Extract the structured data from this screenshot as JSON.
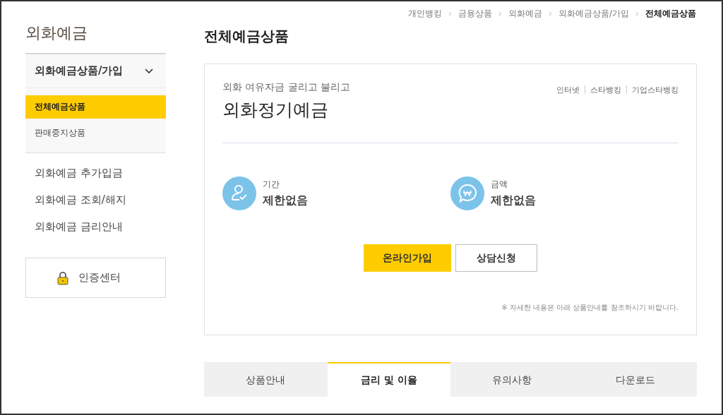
{
  "breadcrumb": [
    {
      "label": "개인뱅킹",
      "current": false
    },
    {
      "label": "금융상품",
      "current": false
    },
    {
      "label": "외화예금",
      "current": false
    },
    {
      "label": "외화예금상품/가입",
      "current": false
    },
    {
      "label": "전체예금상품",
      "current": true
    }
  ],
  "sidebar": {
    "title": "외화예금",
    "group": {
      "label": "외화예금상품/가입",
      "expanded": true,
      "children": [
        {
          "label": "전체예금상품",
          "selected": true
        },
        {
          "label": "판매중지상품",
          "selected": false
        }
      ]
    },
    "items": [
      "외화예금 추가입금",
      "외화예금 조회/해지",
      "외화예금 금리안내"
    ],
    "auth_button": "인증센터"
  },
  "page_title": "전체예금상품",
  "product": {
    "subtitle": "외화 여유자금 굴리고 불리고",
    "name": "외화정기예금",
    "channels": [
      "인터넷",
      "스타뱅킹",
      "기업스타뱅킹"
    ],
    "features": [
      {
        "kind": "person",
        "label": "기간",
        "value": "제한없음"
      },
      {
        "kind": "won",
        "label": "금액",
        "value": "제한없음"
      }
    ],
    "buttons": [
      {
        "kind": "primary",
        "label": "온라인가입"
      },
      {
        "kind": "secondary",
        "label": "상담신청"
      }
    ],
    "note": "※ 자세한 내용은 아래 상품안내를 참조하시기 바랍니다."
  },
  "tabs": [
    {
      "label": "상품안내",
      "selected": false
    },
    {
      "label": "금리 및 이율",
      "selected": true
    },
    {
      "label": "유의사항",
      "selected": false
    },
    {
      "label": "다운로드",
      "selected": false
    }
  ]
}
